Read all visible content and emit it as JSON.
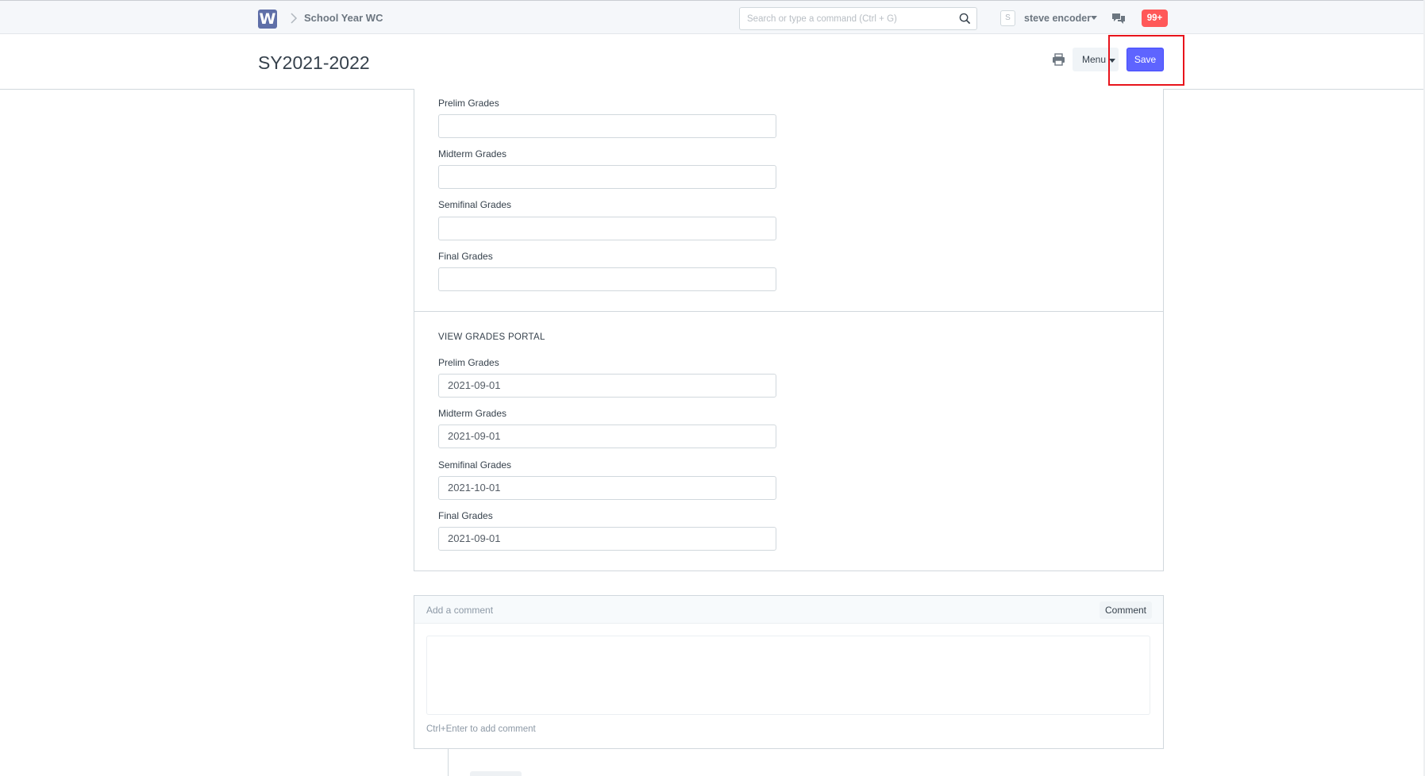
{
  "navbar": {
    "logo_letter": "W",
    "breadcrumb": "School Year WC",
    "search_placeholder": "Search or type a command (Ctrl + G)",
    "avatar_initial": "S",
    "user_name": "steve encoder",
    "notifications": "99+"
  },
  "page": {
    "title": "SY2021-2022",
    "menu_label": "Menu",
    "save_label": "Save"
  },
  "form": {
    "section1_fields": [
      {
        "label": "Prelim Grades",
        "value": ""
      },
      {
        "label": "Midterm Grades",
        "value": ""
      },
      {
        "label": "Semifinal Grades",
        "value": ""
      },
      {
        "label": "Final Grades",
        "value": ""
      }
    ],
    "section2_heading": "VIEW GRADES PORTAL",
    "section2_fields": [
      {
        "label": "Prelim Grades",
        "value": "2021-09-01"
      },
      {
        "label": "Midterm Grades",
        "value": "2021-09-01"
      },
      {
        "label": "Semifinal Grades",
        "value": "2021-10-01"
      },
      {
        "label": "Final Grades",
        "value": "2021-09-01"
      }
    ]
  },
  "comment": {
    "header_label": "Add a comment",
    "button_label": "Comment",
    "hint": "Ctrl+Enter to add comment"
  },
  "colors": {
    "primary": "#5e64ff",
    "badge": "#ff5858",
    "annotation": "#e8141c"
  }
}
